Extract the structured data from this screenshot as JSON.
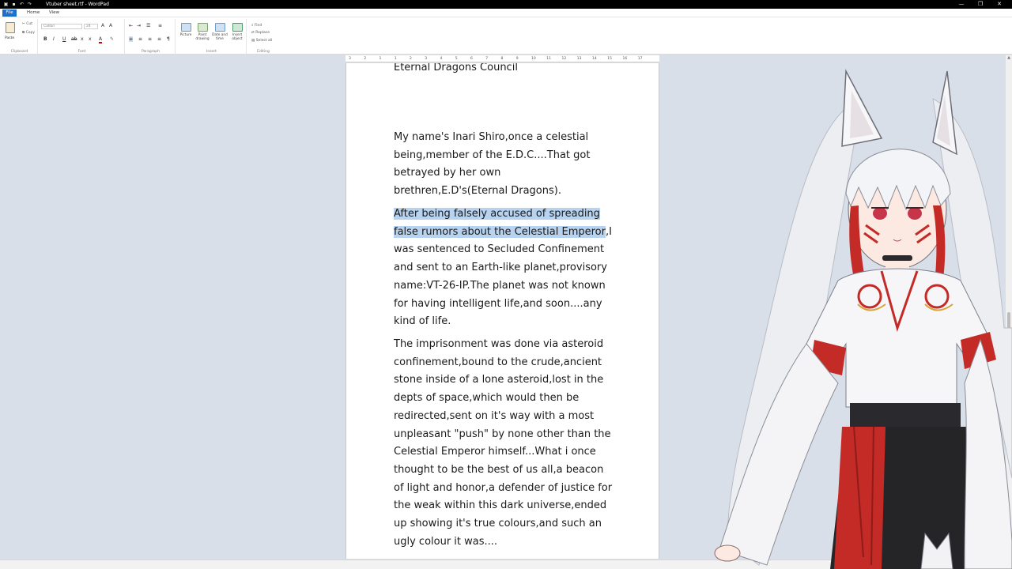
{
  "window": {
    "title": "Vtuber sheet.rtf - WordPad",
    "controls": [
      "—",
      "❐",
      "✕"
    ]
  },
  "tabs": {
    "file": "File",
    "home": "Home",
    "view": "View"
  },
  "ribbon": {
    "clipboard": {
      "paste": "Paste",
      "cut": "Cut",
      "copy": "Copy",
      "group": "Clipboard"
    },
    "font": {
      "family": "Calibri",
      "size": "24",
      "group": "Font"
    },
    "paragraph": {
      "group": "Paragraph"
    },
    "insert": {
      "picture": "Picture",
      "paint_drawing": "Paint drawing",
      "date_time": "Date and time",
      "insert_object": "Insert object",
      "group": "Insert"
    },
    "editing": {
      "find": "Find",
      "replace": "Replace",
      "select_all": "Select all",
      "group": "Editing"
    }
  },
  "ruler": {
    "ticks": [
      "3",
      "2",
      "1",
      "1",
      "2",
      "3",
      "4",
      "5",
      "6",
      "7",
      "8",
      "9",
      "10",
      "11",
      "12",
      "13",
      "14",
      "15",
      "16",
      "17"
    ]
  },
  "document": {
    "heading": "Eternal Dragons Council",
    "para1": "My name's Inari Shiro,once a celestial being,member of the E.D.C....That got betrayed by her own brethren,E.D's(Eternal Dragons).",
    "para2_selected": "After being falsely accused of spreading false rumors about the Celestial Emperor",
    "para2_rest": ",I was sentenced to Secluded Confinement and sent to an Earth-like planet,provisory name:VT-26-IP.The planet was not known for having intelligent life,and soon....any kind of life.",
    "para3": "The imprisonment was done via asteroid confinement,bound to the crude,ancient stone inside of a lone asteroid,lost in the depts of space,which would then be redirected,sent on it's way with a most unpleasant \"push\" by none other than the Celestial Emperor himself...What i once thought to be the best of us all,a beacon of light and honor,a defender of justice for the weak within this dark universe,ended up showing it's true colours,and such an ugly colour it was...."
  },
  "colors": {
    "selection": "#b7d3ef",
    "file_tab": "#1e6fc9",
    "background": "#d8dfe8"
  },
  "icons": {
    "window": "wordpad-icon",
    "avatar": "vtuber-avatar"
  }
}
